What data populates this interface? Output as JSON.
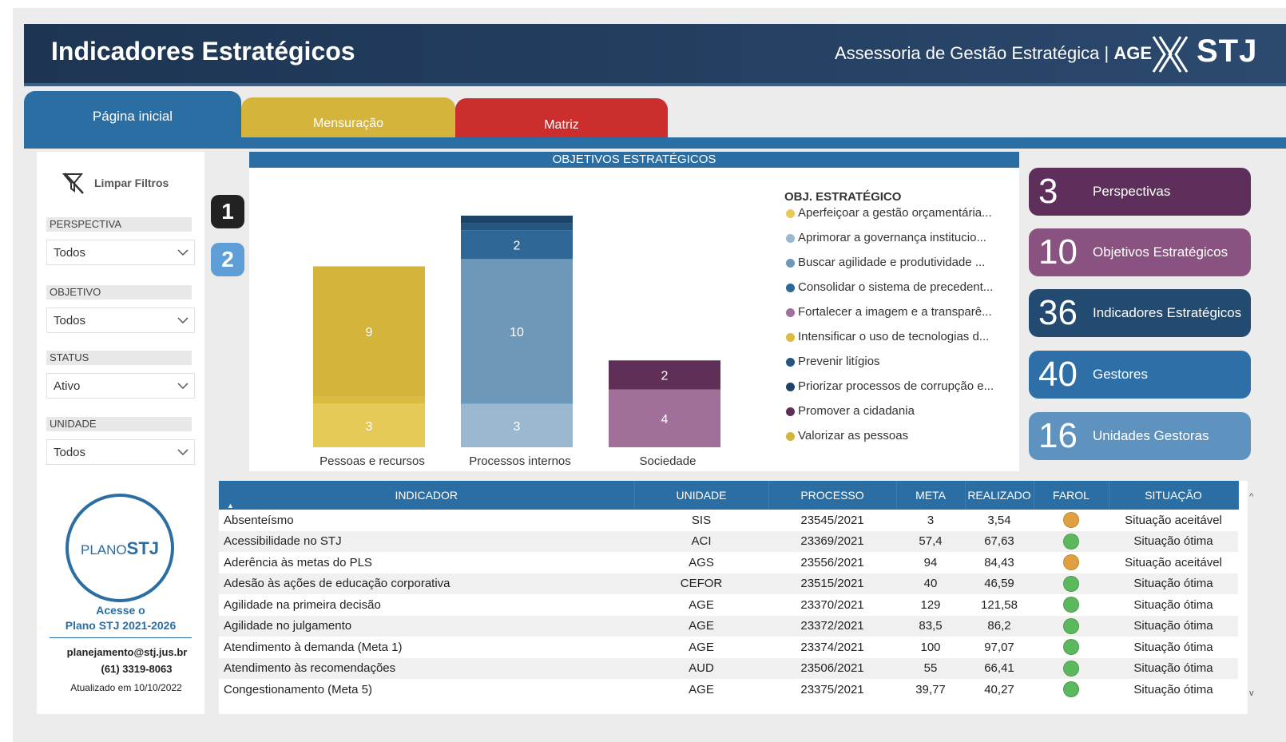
{
  "header": {
    "title": "Indicadores Estratégicos",
    "subtitle": "Assessoria de Gestão Estratégica | ",
    "subtitle_bold": "AGE",
    "logo_text": "STJ"
  },
  "tabs": [
    {
      "label": "Página inicial",
      "color": "#2a6ea3"
    },
    {
      "label": "Mensuração",
      "color": "#d4b43a"
    },
    {
      "label": "Matriz",
      "color": "#cc2d2d"
    }
  ],
  "filters": {
    "clear_label": "Limpar Filtros",
    "perspectiva": {
      "label": "PERSPECTIVA",
      "value": "Todos"
    },
    "objetivo": {
      "label": "OBJETIVO",
      "value": "Todos"
    },
    "status": {
      "label": "STATUS",
      "value": "Ativo"
    },
    "unidade": {
      "label": "UNIDADE",
      "value": "Todos"
    }
  },
  "sidebar_footer": {
    "logo_text_a": "PLANO",
    "logo_text_b": "STJ",
    "access_line1": "Acesse o",
    "access_line2": "Plano STJ 2021-2026",
    "email": "planejamento@stj.jus.br",
    "phone": "(61) 3319-8063",
    "updated": "Atualizado em 10/10/2022"
  },
  "badges": [
    "1",
    "2"
  ],
  "chart_title": "OBJETIVOS ESTRATÉGICOS",
  "chart_data": {
    "type": "bar",
    "stacked": true,
    "categories": [
      "Pessoas e recursos",
      "Processos internos",
      "Sociedade"
    ],
    "segments": [
      [
        {
          "value": 3,
          "color": "#e6ca58",
          "label": "3"
        },
        {
          "value": 0.5,
          "color": "#dcbc3e",
          "label": ""
        },
        {
          "value": 9,
          "color": "#d4b43a",
          "label": "9"
        }
      ],
      [
        {
          "value": 3,
          "color": "#9ab9d1",
          "label": "3"
        },
        {
          "value": 10,
          "color": "#6d98ba",
          "label": "10"
        },
        {
          "value": 2,
          "color": "#2f6796",
          "label": "2"
        },
        {
          "value": 0.5,
          "color": "#25557e",
          "label": ""
        },
        {
          "value": 0.5,
          "color": "#1d4468",
          "label": ""
        }
      ],
      [
        {
          "value": 4,
          "color": "#a06f9a",
          "label": "4"
        },
        {
          "value": 2,
          "color": "#5f2f58",
          "label": "2"
        }
      ]
    ],
    "ylim": [
      0,
      16
    ],
    "legend": {
      "title": "OBJ. ESTRATÉGICO",
      "items": [
        {
          "label": "Aperfeiçoar a gestão orçamentária...",
          "color": "#e6ca58"
        },
        {
          "label": "Aprimorar a governança institucio...",
          "color": "#9ab9d1"
        },
        {
          "label": "Buscar agilidade e produtividade ...",
          "color": "#6d98ba"
        },
        {
          "label": "Consolidar o sistema de precedent...",
          "color": "#2f6796"
        },
        {
          "label": "Fortalecer a imagem e a transparê...",
          "color": "#a06f9a"
        },
        {
          "label": "Intensificar o uso de tecnologias d...",
          "color": "#dcbc3e"
        },
        {
          "label": "Prevenir litígios",
          "color": "#25557e"
        },
        {
          "label": "Priorizar processos de corrupção e...",
          "color": "#1d4468"
        },
        {
          "label": "Promover a cidadania",
          "color": "#5f2f58"
        },
        {
          "label": "Valorizar as pessoas",
          "color": "#d4b43a"
        }
      ]
    }
  },
  "kpis": [
    {
      "value": "3",
      "label": "Perspectivas",
      "color": "#5e2f5b"
    },
    {
      "value": "10",
      "label": "Objetivos Estratégicos",
      "color": "#8a5280"
    },
    {
      "value": "36",
      "label": "Indicadores Estratégicos",
      "color": "#234a70"
    },
    {
      "value": "40",
      "label": "Gestores",
      "color": "#2d6fa6"
    },
    {
      "value": "16",
      "label": "Unidades Gestoras",
      "color": "#5f93bf"
    }
  ],
  "table": {
    "headers": [
      "INDICADOR",
      "UNIDADE",
      "PROCESSO",
      "META",
      "REALIZADO",
      "FAROL",
      "SITUAÇÃO"
    ],
    "rows": [
      {
        "indicador": "Absenteísmo",
        "unidade": "SIS",
        "processo": "23545/2021",
        "meta": "3",
        "realizado": "3,54",
        "farol": "#e0a040",
        "situacao": "Situação aceitável"
      },
      {
        "indicador": "Acessibilidade no STJ",
        "unidade": "ACI",
        "processo": "23369/2021",
        "meta": "57,4",
        "realizado": "67,63",
        "farol": "#5cb85c",
        "situacao": "Situação ótima"
      },
      {
        "indicador": "Aderência às metas do PLS",
        "unidade": "AGS",
        "processo": "23556/2021",
        "meta": "94",
        "realizado": "84,43",
        "farol": "#e0a040",
        "situacao": "Situação aceitável"
      },
      {
        "indicador": "Adesão às ações de educação corporativa",
        "unidade": "CEFOR",
        "processo": "23515/2021",
        "meta": "40",
        "realizado": "46,59",
        "farol": "#5cb85c",
        "situacao": "Situação ótima"
      },
      {
        "indicador": "Agilidade na primeira decisão",
        "unidade": "AGE",
        "processo": "23370/2021",
        "meta": "129",
        "realizado": "121,58",
        "farol": "#5cb85c",
        "situacao": "Situação ótima"
      },
      {
        "indicador": "Agilidade no julgamento",
        "unidade": "AGE",
        "processo": "23372/2021",
        "meta": "83,5",
        "realizado": "86,2",
        "farol": "#5cb85c",
        "situacao": "Situação ótima"
      },
      {
        "indicador": "Atendimento à demanda (Meta 1)",
        "unidade": "AGE",
        "processo": "23374/2021",
        "meta": "100",
        "realizado": "97,07",
        "farol": "#5cb85c",
        "situacao": "Situação ótima"
      },
      {
        "indicador": "Atendimento às recomendações",
        "unidade": "AUD",
        "processo": "23506/2021",
        "meta": "55",
        "realizado": "66,41",
        "farol": "#5cb85c",
        "situacao": "Situação ótima"
      },
      {
        "indicador": "Congestionamento (Meta 5)",
        "unidade": "AGE",
        "processo": "23375/2021",
        "meta": "39,77",
        "realizado": "40,27",
        "farol": "#5cb85c",
        "situacao": "Situação ótima"
      }
    ]
  }
}
